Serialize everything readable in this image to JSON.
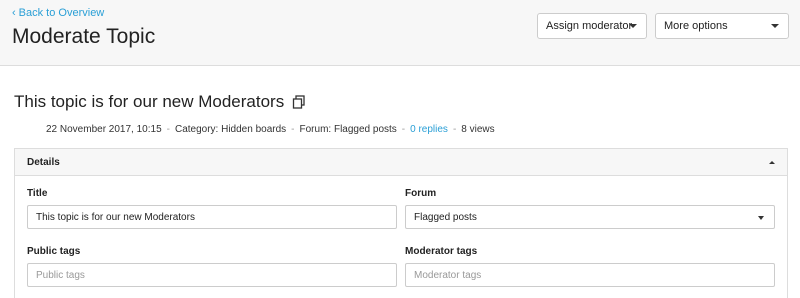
{
  "header": {
    "back_label": "Back to Overview",
    "page_title": "Moderate Topic",
    "assign_label": "Assign moderator",
    "more_label": "More options"
  },
  "topic": {
    "title": "This topic is for our new Moderators",
    "date": "22 November 2017, 10:15",
    "category": "Category: Hidden boards",
    "forum": "Forum: Flagged posts",
    "replies": "0 replies",
    "views": "8 views",
    "separator": "-"
  },
  "details": {
    "heading": "Details",
    "title_label": "Title",
    "title_value": "This topic is for our new Moderators",
    "forum_label": "Forum",
    "forum_value": "Flagged posts",
    "public_tags_label": "Public tags",
    "public_tags_placeholder": "Public tags",
    "moderator_tags_label": "Moderator tags",
    "moderator_tags_placeholder": "Moderator tags"
  },
  "colors": {
    "accent": "#2a9fd6",
    "header_bg": "#f7f7f7",
    "border": "#dddddd"
  },
  "icons": {
    "back": "chevron-left-icon",
    "copy": "copy-icon",
    "dropdown": "caret-down-icon",
    "collapse": "caret-up-icon"
  }
}
